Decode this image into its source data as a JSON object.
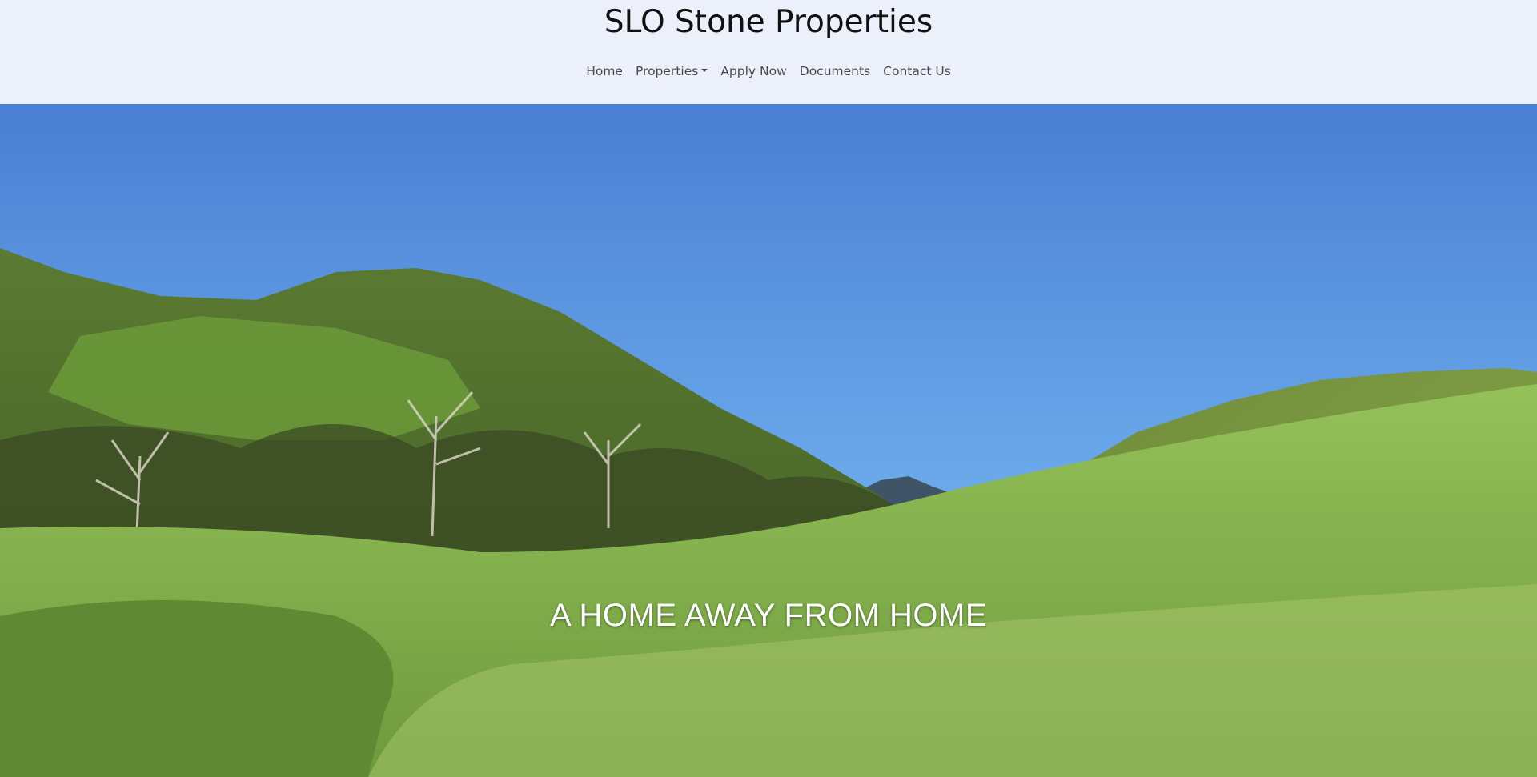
{
  "site": {
    "title": "SLO Stone Properties"
  },
  "nav": {
    "items": [
      {
        "label": "Home"
      },
      {
        "label": "Properties",
        "dropdown": true
      },
      {
        "label": "Apply Now"
      },
      {
        "label": "Documents"
      },
      {
        "label": "Contact Us"
      }
    ]
  },
  "hero": {
    "tagline": "A HOME AWAY FROM HOME",
    "image_description_icon": "landscape-photo"
  },
  "colors": {
    "header_bg": "#ecf0fb",
    "sky_top": "#4a7fd3",
    "sky_bottom": "#6aa8ea",
    "grass": "#7db54a",
    "hill_dark": "#4b6a2b"
  }
}
